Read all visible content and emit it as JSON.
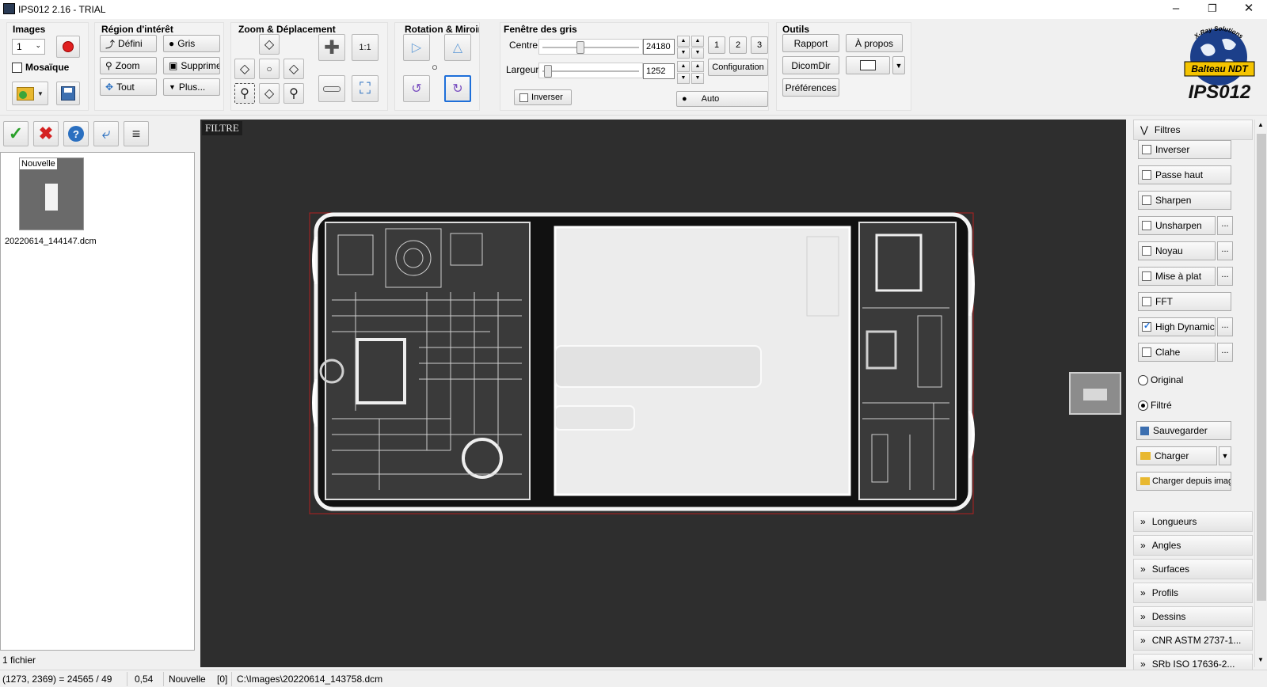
{
  "window": {
    "title": "IPS012 2.16 - TRIAL"
  },
  "brand": {
    "badge_arc": "X-Ray Solutions",
    "badge_name": "Balteau NDT",
    "product": "IPS012"
  },
  "images_group": {
    "title": "Images",
    "select_value": "1",
    "mosaique_label": "Mosaïque"
  },
  "roi_group": {
    "title": "Région d'intérêt",
    "defini": "Défini",
    "gris": "Gris",
    "zoom": "Zoom",
    "supprime": "Supprime",
    "tout": "Tout",
    "plus": "Plus..."
  },
  "zoom_group": {
    "title": "Zoom & Déplacement",
    "one_to_one": "1:1"
  },
  "rotation_group": {
    "title": "Rotation & Miroir"
  },
  "gray_window": {
    "title": "Fenêtre des gris",
    "centre_label": "Centre",
    "centre_value": "24180",
    "largeur_label": "Largeur",
    "largeur_value": "1252",
    "preset1": "1",
    "preset2": "2",
    "preset3": "3",
    "configuration": "Configuration",
    "inverser": "Inverser",
    "auto": "Auto",
    "centre_fraction": 0.38,
    "largeur_fraction": 0.02
  },
  "tools": {
    "title": "Outils",
    "rapport": "Rapport",
    "apropos": "À propos",
    "dicomdir": "DicomDir",
    "preferences": "Préférences"
  },
  "thumbnail": {
    "badge": "Nouvelle",
    "filename": "20220614_144147.dcm"
  },
  "left_footer": "1 fichier",
  "viewer": {
    "label": "FILTRE"
  },
  "filters": {
    "header": "Filtres",
    "items": [
      {
        "label": "Inverser",
        "checked": false,
        "options": false
      },
      {
        "label": "Passe haut",
        "checked": false,
        "options": false
      },
      {
        "label": "Sharpen",
        "checked": false,
        "options": false
      },
      {
        "label": "Unsharpen",
        "checked": false,
        "options": true
      },
      {
        "label": "Noyau",
        "checked": false,
        "options": true
      },
      {
        "label": "Mise à plat",
        "checked": false,
        "options": true
      },
      {
        "label": "FFT",
        "checked": false,
        "options": false
      },
      {
        "label": "High Dynamic",
        "checked": true,
        "options": true
      },
      {
        "label": "Clahe",
        "checked": false,
        "options": true
      }
    ],
    "options_label": "...",
    "radio_original": "Original",
    "radio_filtre": "Filtré",
    "sauvegarder": "Sauvegarder",
    "charger": "Charger",
    "charger_image": "Charger depuis image"
  },
  "sections": [
    "Longueurs",
    "Angles",
    "Surfaces",
    "Profils",
    "Dessins",
    "CNR ASTM 2737-1...",
    "SRb ISO 17636-2..."
  ],
  "status": {
    "coords": "(1273, 2369) = 24565 / 49",
    "zoom": "0,54",
    "name": "Nouvelle",
    "index": "[0]",
    "path": "C:\\Images\\20220614_143758.dcm"
  },
  "colors": {
    "accent": "#1e6fd9",
    "viewer_bg": "#2e2e2e",
    "record_red": "#e02020",
    "check_green": "#2aa02a",
    "cancel_red": "#d42020"
  }
}
